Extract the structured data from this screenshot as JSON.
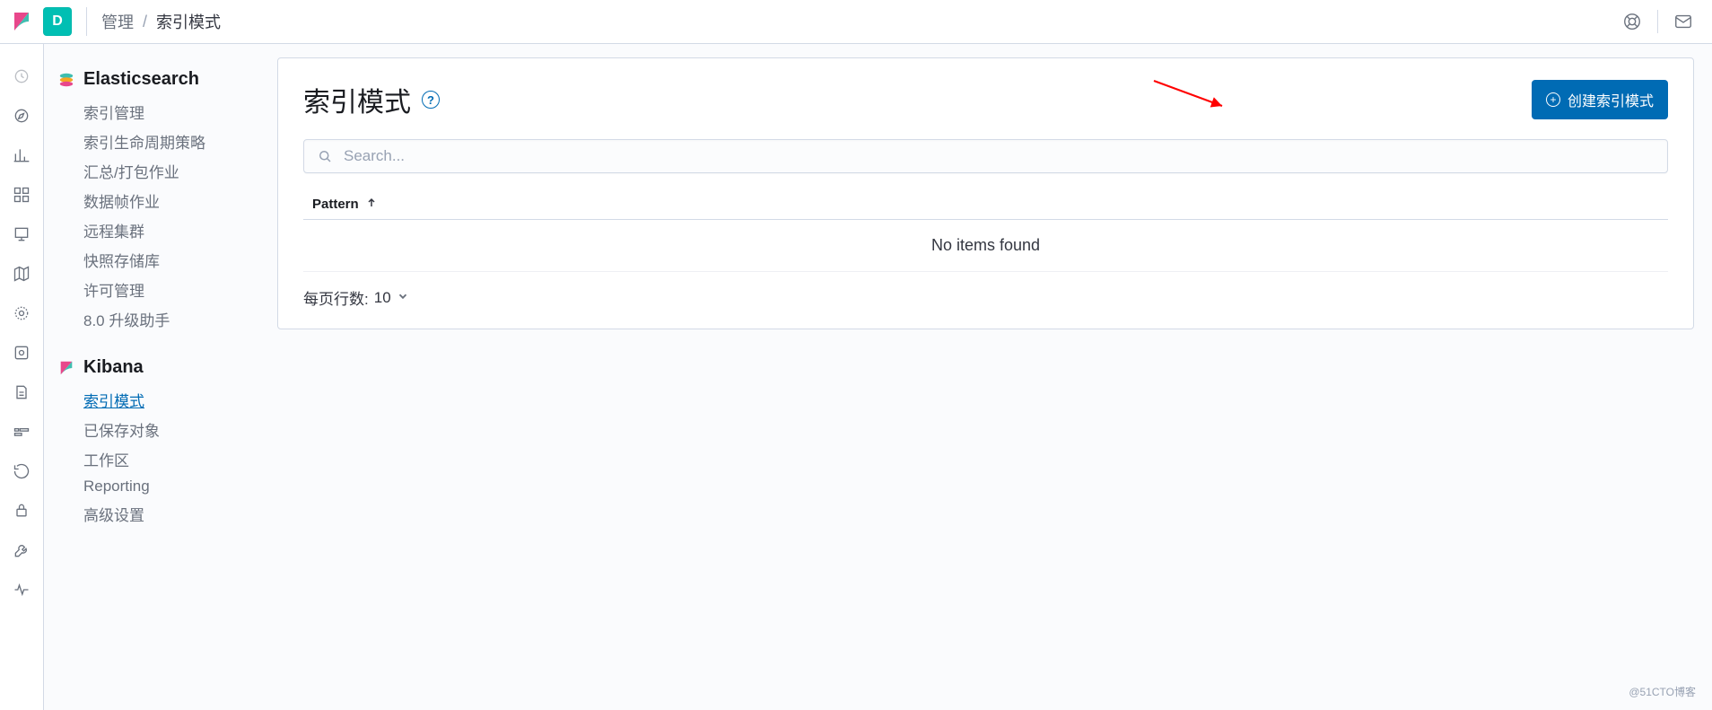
{
  "header": {
    "space_initial": "D",
    "breadcrumb_parent": "管理",
    "breadcrumb_sep": "/",
    "breadcrumb_current": "索引模式"
  },
  "sidebar": {
    "es_title": "Elasticsearch",
    "es_items": [
      {
        "label": "索引管理"
      },
      {
        "label": "索引生命周期策略"
      },
      {
        "label": "汇总/打包作业"
      },
      {
        "label": "数据帧作业"
      },
      {
        "label": "远程集群"
      },
      {
        "label": "快照存储库"
      },
      {
        "label": "许可管理"
      },
      {
        "label": "8.0 升级助手"
      }
    ],
    "kb_title": "Kibana",
    "kb_items": [
      {
        "label": "索引模式",
        "active": true
      },
      {
        "label": "已保存对象"
      },
      {
        "label": "工作区"
      },
      {
        "label": "Reporting"
      },
      {
        "label": "高级设置"
      }
    ]
  },
  "main": {
    "title": "索引模式",
    "help_glyph": "?",
    "create_btn_label": "创建索引模式",
    "search_placeholder": "Search...",
    "table": {
      "column_pattern": "Pattern",
      "empty_text": "No items found"
    },
    "pager": {
      "label": "每页行数:",
      "value": "10"
    }
  },
  "watermark": "@51CTO博客",
  "brand_colors": {
    "primary": "#006bb4",
    "pink": "#e8478b",
    "teal": "#00bfb3"
  }
}
